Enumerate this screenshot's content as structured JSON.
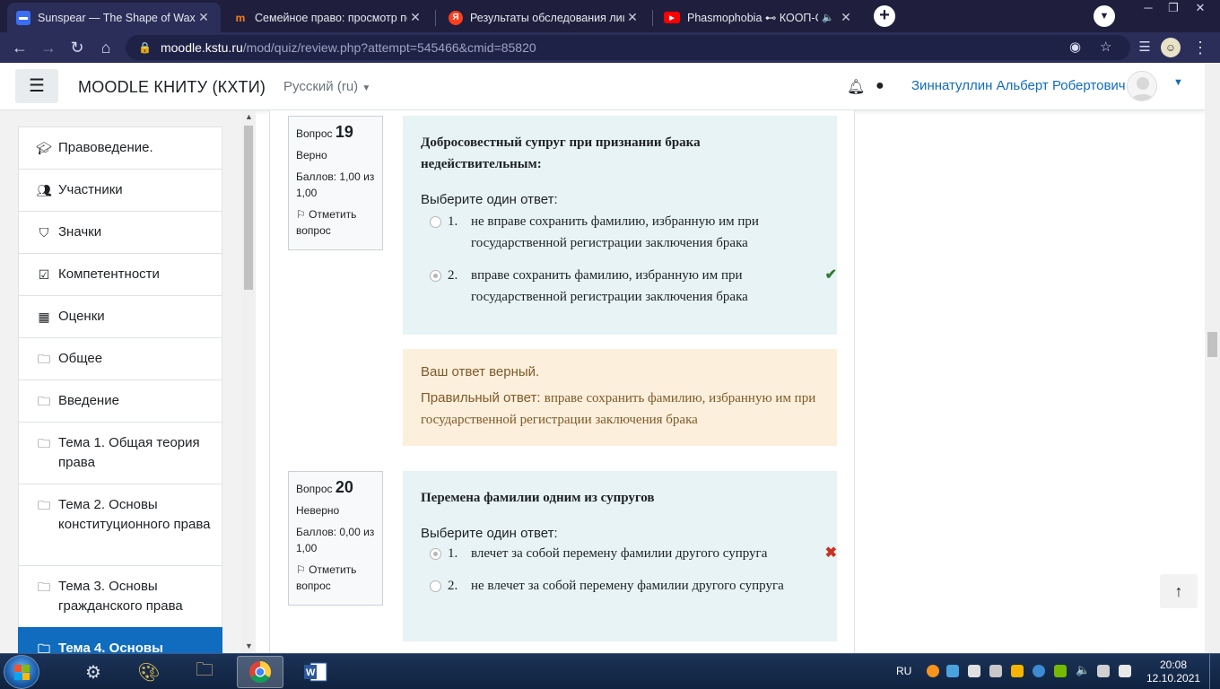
{
  "browser": {
    "tabs": [
      {
        "title": "Sunspear — The Shape of Wax",
        "icon": "chat-favicon",
        "color": "#3b6ef5"
      },
      {
        "title": "Семейное право: просмотр поп",
        "icon": "moodle-favicon",
        "color": "#f98012"
      },
      {
        "title": "Результаты обследования лица",
        "icon": "yandex-favicon",
        "color": "#fc3f1d"
      },
      {
        "title": "Phasmophobia ⊷ КООП-СТР",
        "icon": "youtube-favicon",
        "color": "#ff0000"
      }
    ],
    "url_host": "moodle.kstu.ru",
    "url_path": "/mod/quiz/review.php?attempt=545466&cmid=85820"
  },
  "navbar": {
    "site_name": "MOODLE КНИТУ (КХТИ)",
    "language": "Русский (ru)",
    "user_name": "Зиннатуллин Альберт Робертович"
  },
  "drawer": {
    "items": [
      {
        "label": "Правоведение.",
        "icon": "graduation-cap-icon"
      },
      {
        "label": "Участники",
        "icon": "users-icon"
      },
      {
        "label": "Значки",
        "icon": "shield-icon"
      },
      {
        "label": "Компетентности",
        "icon": "checkbox-icon"
      },
      {
        "label": "Оценки",
        "icon": "table-icon"
      },
      {
        "label": "Общее",
        "icon": "folder-icon"
      },
      {
        "label": "Введение",
        "icon": "folder-icon"
      },
      {
        "label": "Тема 1. Общая теория права",
        "icon": "folder-icon"
      },
      {
        "label": "Тема 2. Основы конституционного права",
        "icon": "folder-icon"
      },
      {
        "label": "Тема 3. Основы гражданского права",
        "icon": "folder-icon"
      },
      {
        "label": "Тема 4. Основы",
        "icon": "folder-icon",
        "active": true
      }
    ]
  },
  "questions": [
    {
      "label": "Вопрос",
      "number": "19",
      "state": "Верно",
      "grade": "Баллов: 1,00 из 1,00",
      "flag": "Отметить вопрос",
      "text": "Добросовестный супруг при признании брака недействительным:",
      "prompt": "Выберите один ответ:",
      "answers": [
        {
          "num": "1.",
          "text": "не вправе сохранить фамилию, избранную им при государственной регистрации заключения брака",
          "checked": false,
          "mark": ""
        },
        {
          "num": "2.",
          "text": "вправе сохранить фамилию, избранную им при государственной регистрации заключения брака",
          "checked": true,
          "mark": "✔"
        }
      ],
      "feedback_status": "Ваш ответ верный.",
      "feedback_label": "Правильный ответ:",
      "feedback_answer": "вправе сохранить фамилию, избранную им при государственной регистрации заключения брака"
    },
    {
      "label": "Вопрос",
      "number": "20",
      "state": "Неверно",
      "grade": "Баллов: 0,00 из 1,00",
      "flag": "Отметить вопрос",
      "text": "Перемена фамилии одним из супругов",
      "prompt": "Выберите один ответ:",
      "answers": [
        {
          "num": "1.",
          "text": "влечет за собой перемену фамилии другого супруга",
          "checked": true,
          "mark": "✖"
        },
        {
          "num": "2.",
          "text": "не влечет за собой перемену фамилии другого супруга",
          "checked": false,
          "mark": ""
        }
      ]
    }
  ],
  "taskbar": {
    "language": "RU",
    "time": "20:08",
    "date": "12.10.2021"
  }
}
